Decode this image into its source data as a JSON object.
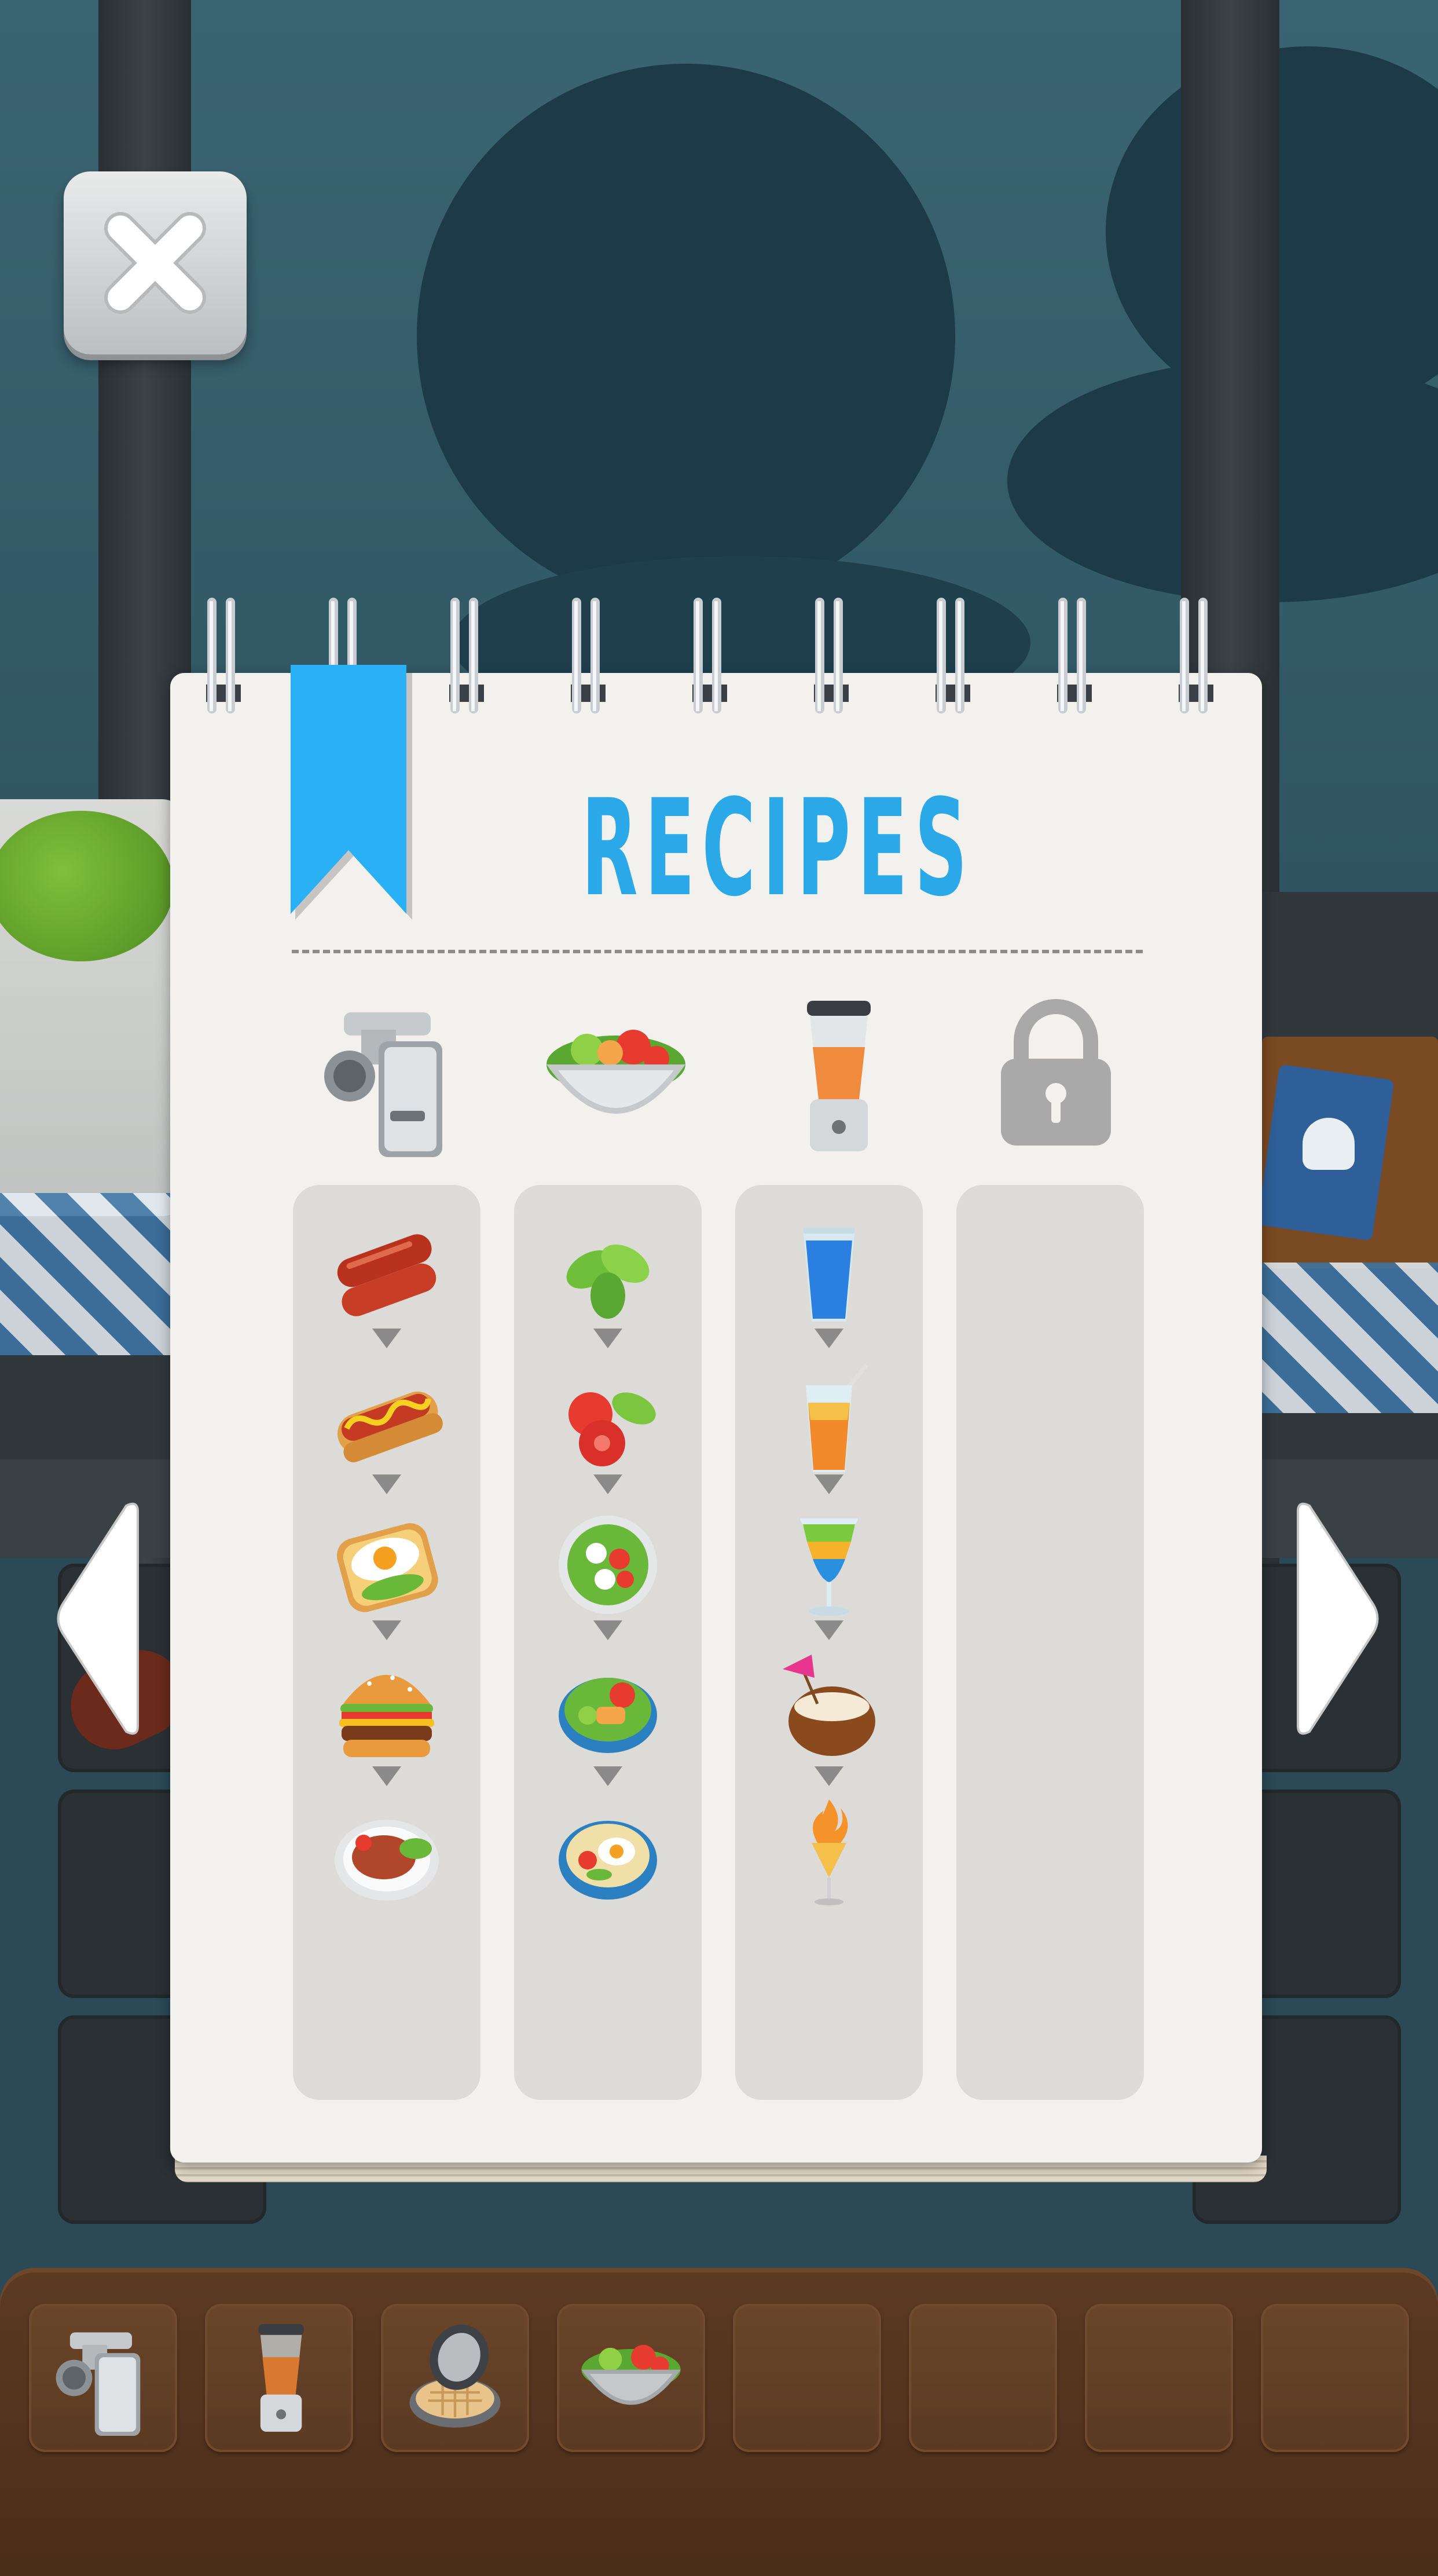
{
  "header": {
    "close_icon": "close-x-icon"
  },
  "notebook": {
    "title": "RECIPES",
    "bookmark_color": "#2ab0f5",
    "title_color": "#2aa8e8",
    "stations": [
      {
        "name": "meat-grinder-icon"
      },
      {
        "name": "salad-bowl-icon"
      },
      {
        "name": "blender-icon"
      },
      {
        "name": "lock-icon",
        "locked": true
      }
    ],
    "columns": [
      {
        "station": "meat-grinder",
        "recipes": [
          "sausages-icon",
          "hot-dog-icon",
          "egg-toast-icon",
          "burger-icon",
          "steak-plate-icon"
        ]
      },
      {
        "station": "salad",
        "recipes": [
          "basil-icon",
          "tomato-basil-icon",
          "caprese-salad-icon",
          "salad-bowl-icon",
          "egg-salad-bowl-icon"
        ]
      },
      {
        "station": "blender",
        "recipes": [
          "blue-drink-icon",
          "orange-juice-icon",
          "layered-cocktail-icon",
          "coconut-drink-icon",
          "flaming-cocktail-icon"
        ]
      },
      {
        "station": "locked",
        "recipes": []
      }
    ]
  },
  "navigation": {
    "prev_icon": "arrow-left-icon",
    "next_icon": "arrow-right-icon"
  },
  "tray": {
    "slots": [
      "meat-grinder-icon",
      "blender-icon",
      "waffle-maker-icon",
      "salad-bowl-icon",
      "empty",
      "empty",
      "empty",
      "empty"
    ]
  }
}
